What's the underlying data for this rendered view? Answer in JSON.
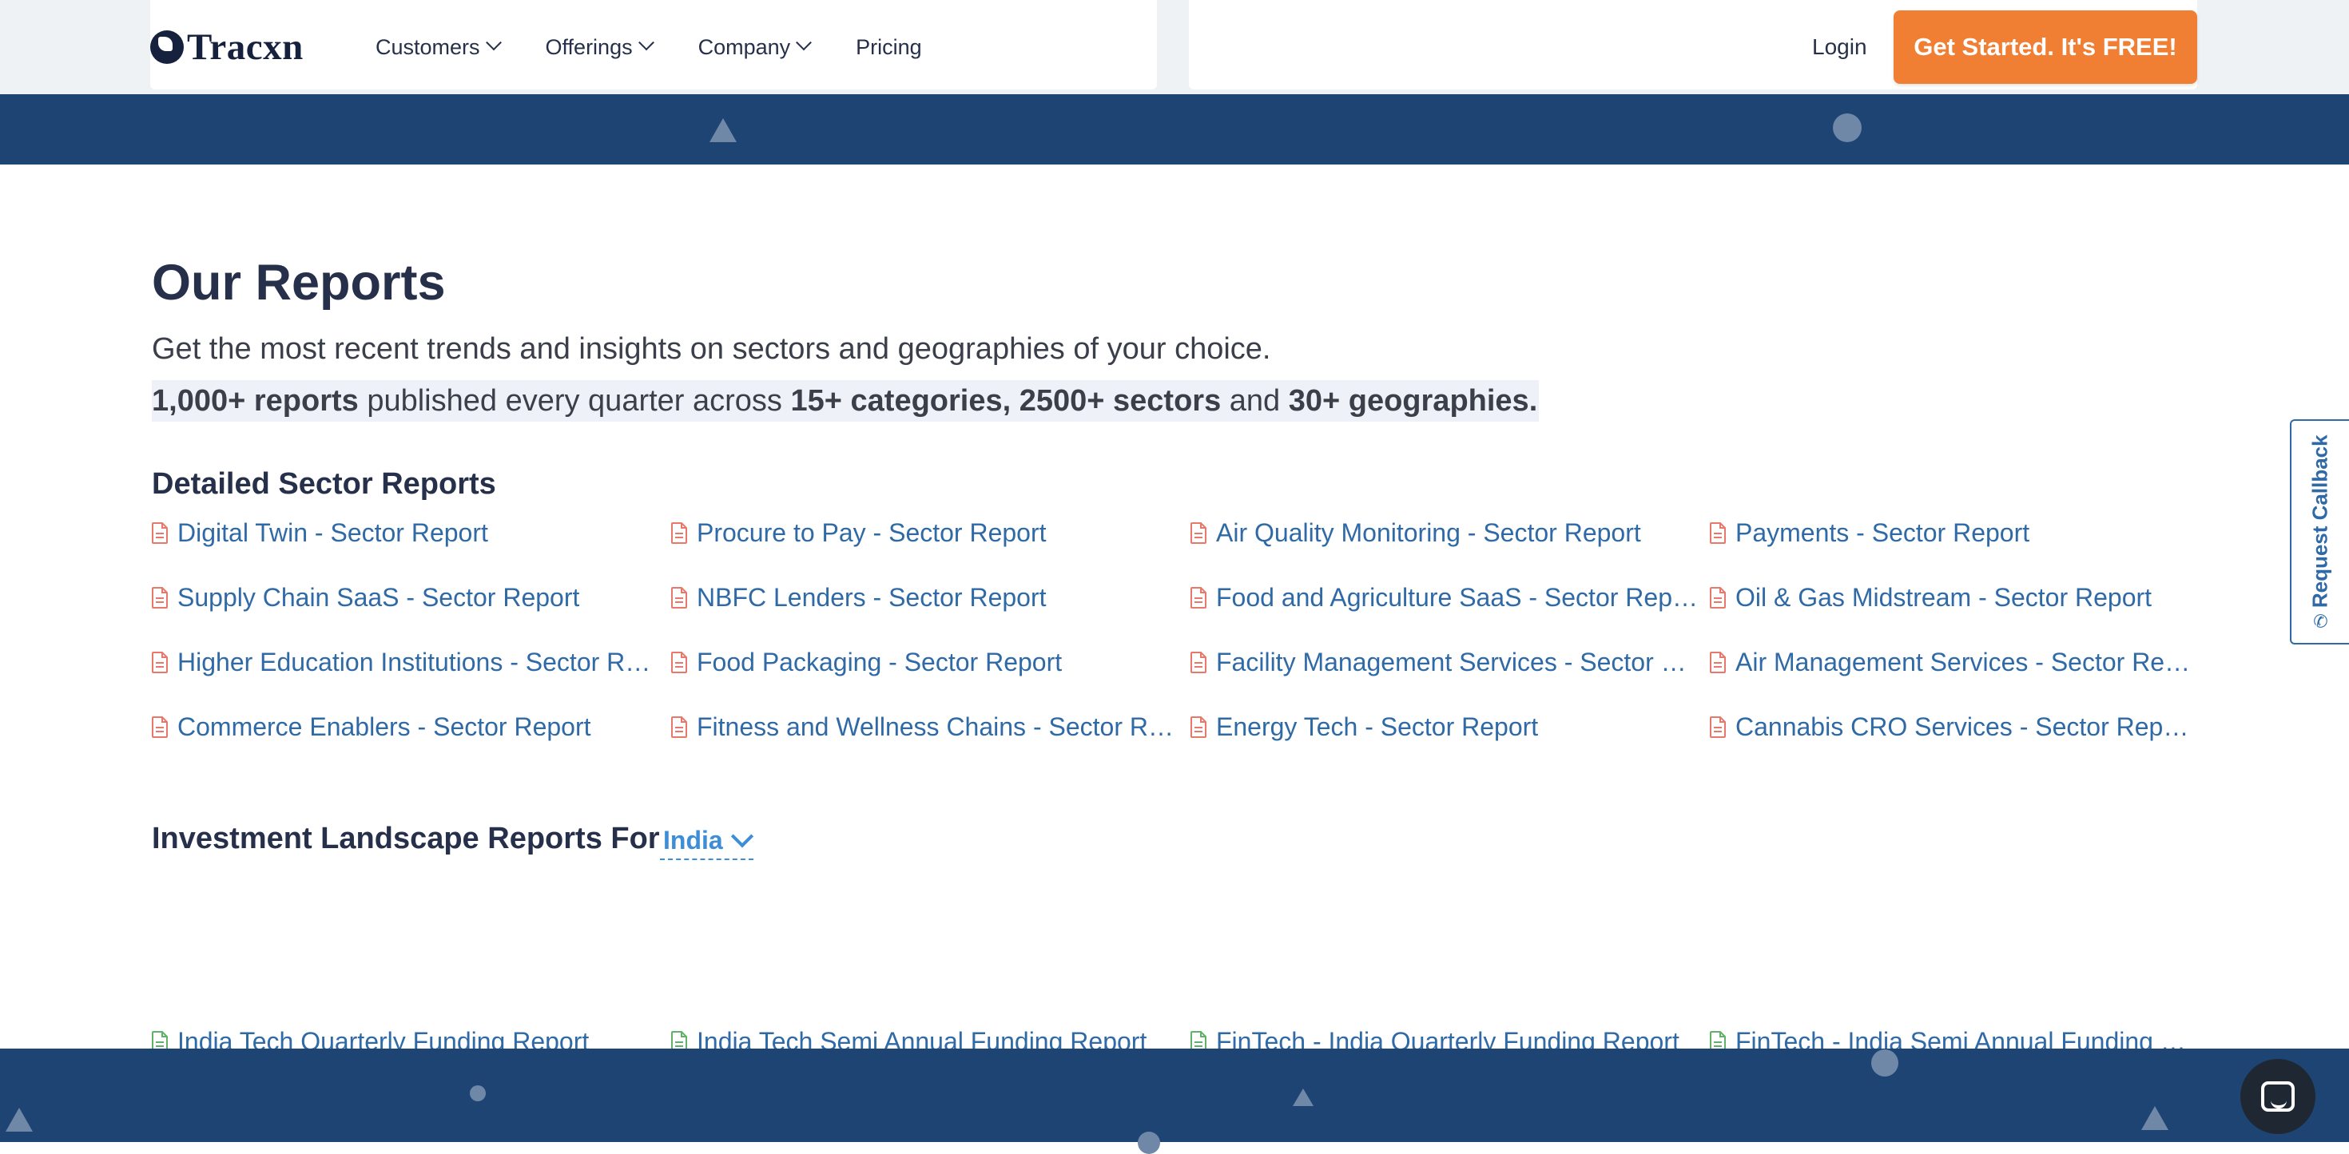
{
  "header": {
    "logo_text": "Tracxn",
    "nav": [
      {
        "label": "Customers",
        "has_dropdown": true
      },
      {
        "label": "Offerings",
        "has_dropdown": true
      },
      {
        "label": "Company",
        "has_dropdown": true
      },
      {
        "label": "Pricing",
        "has_dropdown": false
      }
    ],
    "login_label": "Login",
    "cta_label": "Get Started. It's FREE!"
  },
  "main": {
    "title": "Our Reports",
    "subtitle": "Get the most recent trends and insights on sectors and geographies of your choice.",
    "stats": {
      "reports": "1,000+ reports",
      "text1": " published every quarter across ",
      "categories_sectors": "15+ categories, 2500+ sectors",
      "text2": " and ",
      "geographies": "30+ geographies."
    },
    "sector_section": {
      "heading": "Detailed Sector Reports",
      "reports": [
        "Digital Twin - Sector Report",
        "Procure to Pay - Sector Report",
        "Air Quality Monitoring - Sector Report",
        "Payments - Sector Report",
        "Supply Chain SaaS - Sector Report",
        "NBFC Lenders - Sector Report",
        "Food and Agriculture SaaS - Sector Report",
        "Oil & Gas Midstream - Sector Report",
        "Higher Education Institutions - Sector Report",
        "Food Packaging - Sector Report",
        "Facility Management Services - Sector Report",
        "Air Management Services - Sector Report",
        "Commerce Enablers - Sector Report",
        "Fitness and Wellness Chains - Sector Report",
        "Energy Tech - Sector Report",
        "Cannabis CRO Services - Sector Report"
      ]
    },
    "investment_section": {
      "heading": "Investment Landscape Reports For",
      "selected_geography": "India",
      "reports": [
        "India Tech Quarterly Funding Report",
        "India Tech Semi Annual Funding Report",
        "FinTech - India Quarterly Funding Report",
        "FinTech - India Semi Annual Funding Report"
      ]
    }
  },
  "widgets": {
    "callback_label": "Request Callback",
    "chat_icon": "chat-icon"
  },
  "colors": {
    "band_blue": "#1d4472",
    "cta_orange": "#f07f34",
    "link_blue": "#2f6aa6",
    "sector_icon": "#e8786a",
    "investment_icon": "#5fb267",
    "geo_select": "#3d8ed6"
  }
}
